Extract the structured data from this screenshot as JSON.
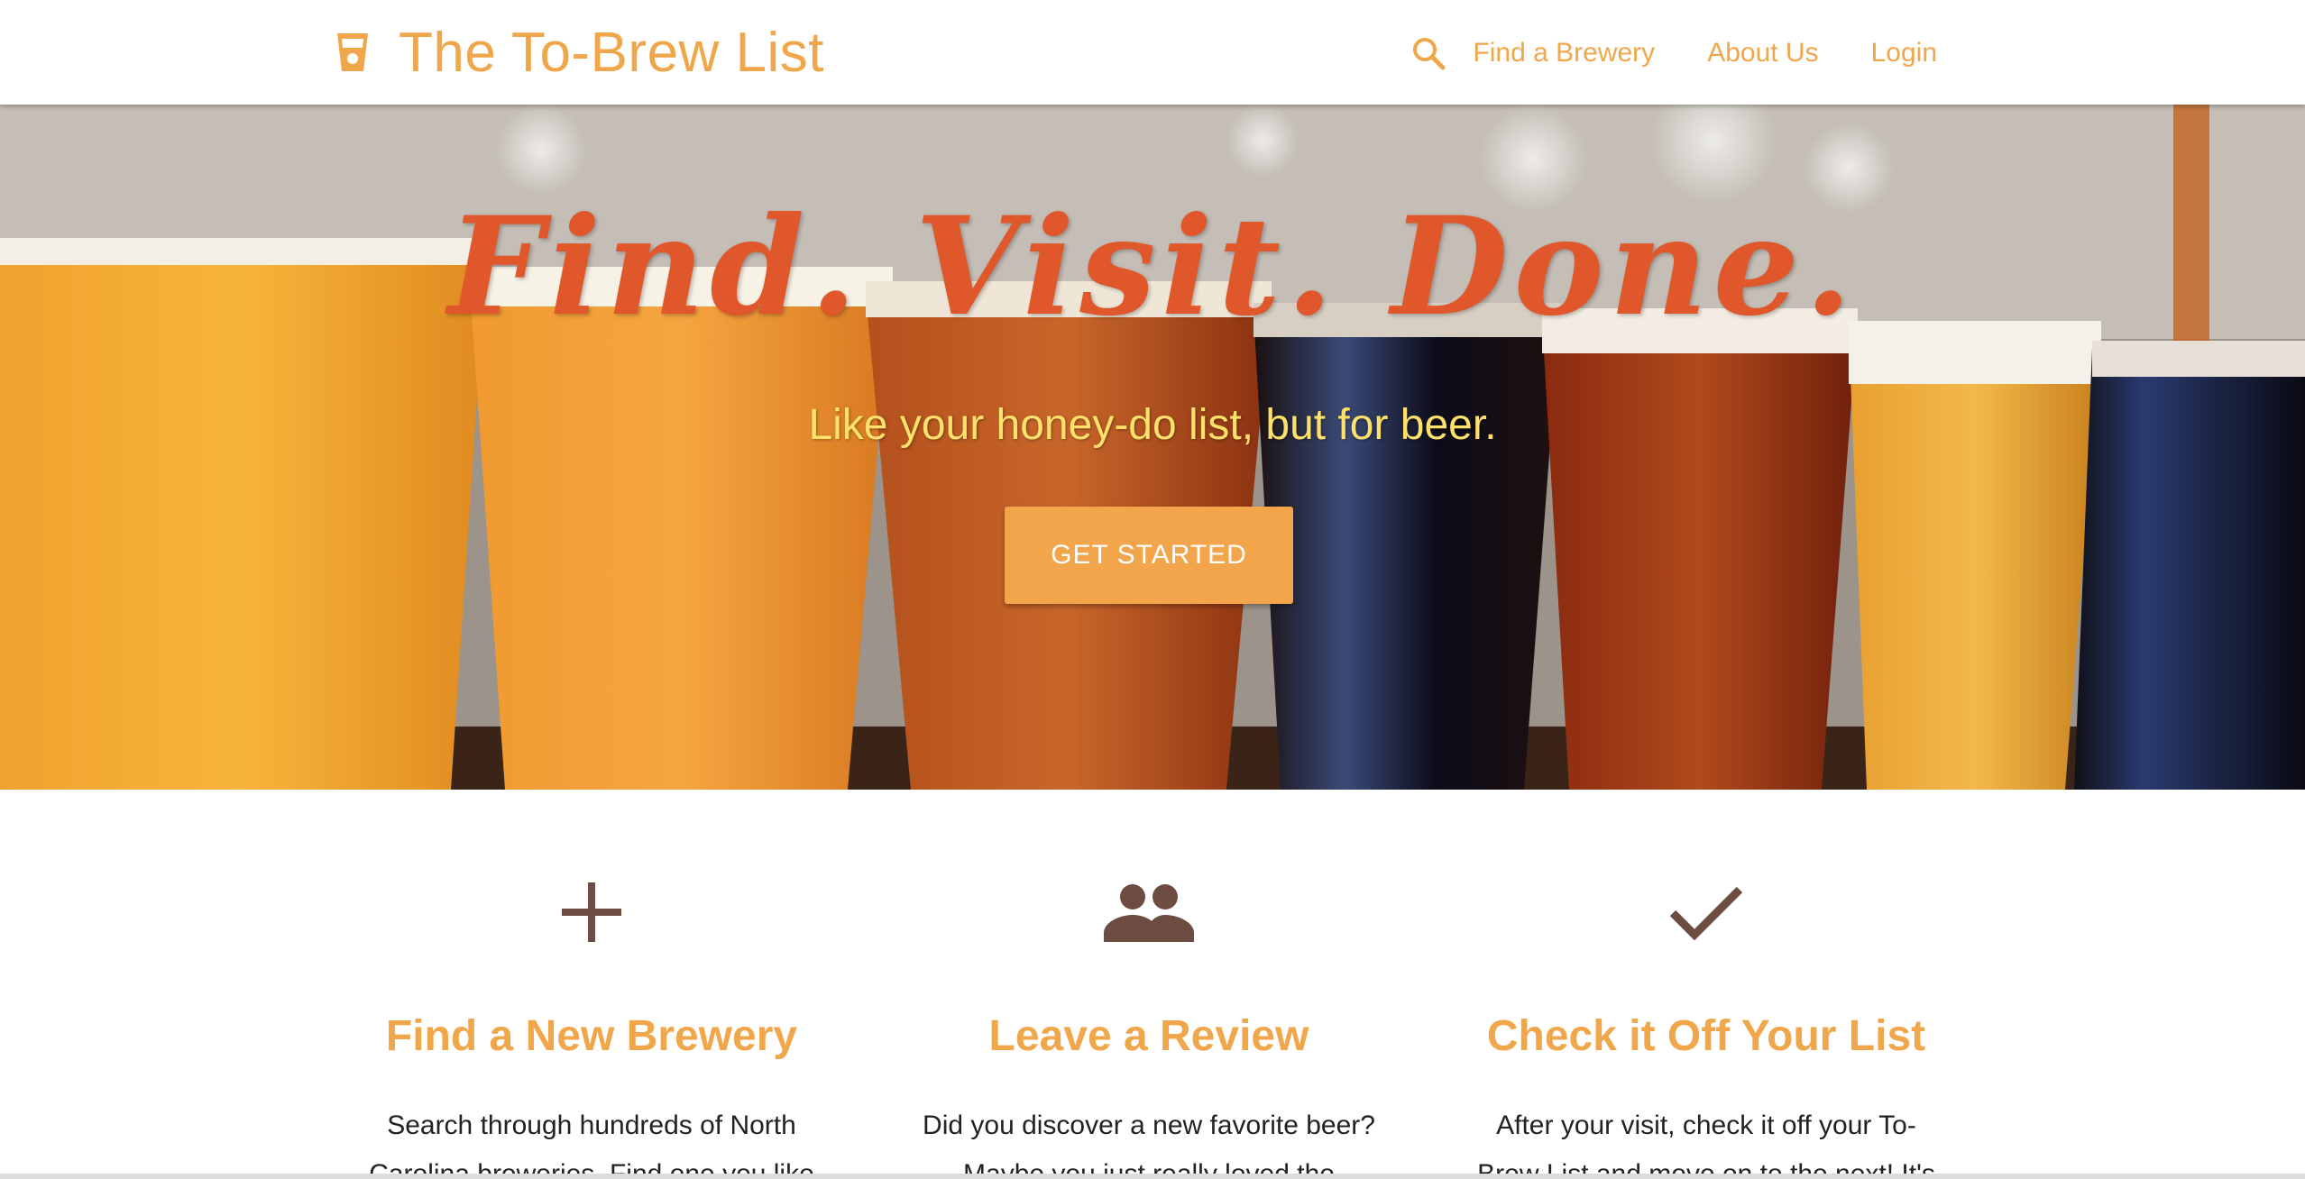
{
  "navbar": {
    "brand_title": "The To-Brew List",
    "brand_icon": "beer-glass-icon",
    "search_icon": "search-icon",
    "links": [
      "Find a Brewery",
      "About Us",
      "Login"
    ]
  },
  "hero": {
    "heading": "Find. Visit. Done.",
    "subheading": "Like your honey-do list, but for beer.",
    "cta_label": "GET STARTED"
  },
  "features": [
    {
      "icon": "add-icon",
      "title": "Find a New Brewery",
      "description": "Search through hundreds of North Carolina breweries. Find one you like"
    },
    {
      "icon": "people-icon",
      "title": "Leave a Review",
      "description": "Did you discover a new favorite beer? Maybe you just really loved the"
    },
    {
      "icon": "check-icon",
      "title": "Check it Off Your List",
      "description": "After your visit, check it off your To-Brew List and move on to the next! It's"
    }
  ],
  "colors": {
    "accent": "#f0a64a",
    "hero_heading": "#e0572b",
    "hero_sub": "#fde16a",
    "icon_brown": "#6d4c41"
  }
}
